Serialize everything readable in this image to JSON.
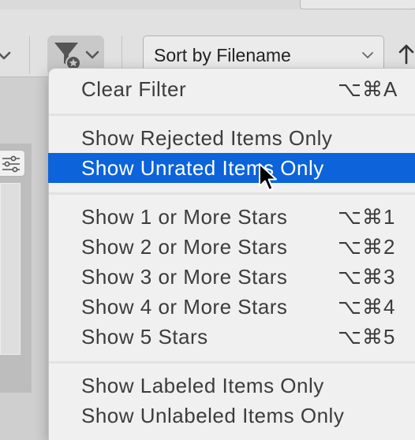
{
  "toolbar": {
    "filter_button_icon": "filter-star-icon",
    "sort_select_value": "Sort by Filename",
    "sort_direction_icon": "arrow-up-icon"
  },
  "menu": {
    "clear": {
      "label": "Clear Filter",
      "shortcut": "⌥⌘A"
    },
    "rejected": {
      "label": "Show Rejected Items Only"
    },
    "unrated": {
      "label": "Show Unrated Items Only"
    },
    "star1": {
      "label": "Show 1 or More Stars",
      "shortcut": "⌥⌘1"
    },
    "star2": {
      "label": "Show 2 or More Stars",
      "shortcut": "⌥⌘2"
    },
    "star3": {
      "label": "Show 3 or More Stars",
      "shortcut": "⌥⌘3"
    },
    "star4": {
      "label": "Show 4 or More Stars",
      "shortcut": "⌥⌘4"
    },
    "star5": {
      "label": "Show 5 Stars",
      "shortcut": "⌥⌘5"
    },
    "labeled": {
      "label": "Show Labeled Items Only"
    },
    "unlabeled": {
      "label": "Show Unlabeled Items Only"
    }
  },
  "colors": {
    "selection": "#0c63da",
    "menu_background": "#f0f0f0",
    "toolbar_background": "#e1e1e1"
  }
}
